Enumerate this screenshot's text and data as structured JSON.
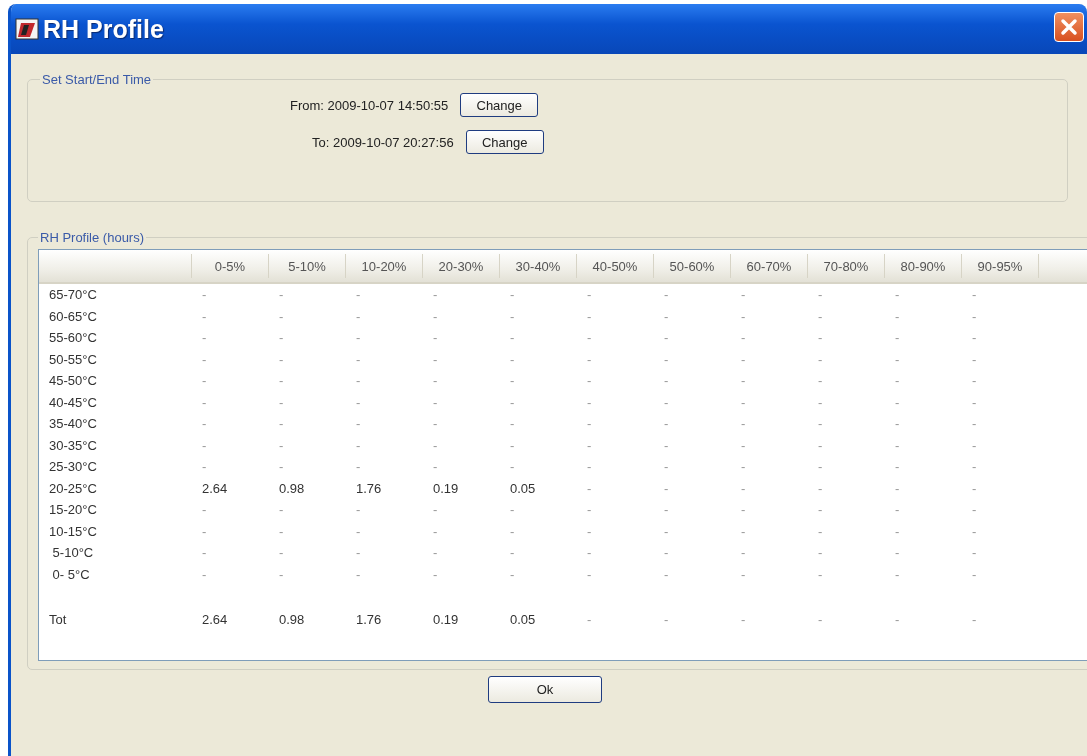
{
  "window": {
    "title": "RH Profile"
  },
  "time_group": {
    "title": "Set Start/End Time",
    "rows": [
      {
        "label": "From: 2009-10-07 14:50:55",
        "button": "Change"
      },
      {
        "label": "To: 2009-10-07 20:27:56",
        "button": "Change"
      }
    ]
  },
  "profile_group": {
    "title": "RH Profile (hours)",
    "table": {
      "columns": [
        "0-5%",
        "5-10%",
        "10-20%",
        "20-30%",
        "30-40%",
        "40-50%",
        "50-60%",
        "60-70%",
        "70-80%",
        "80-90%",
        "90-95%"
      ],
      "rows": [
        {
          "kind": "data",
          "label": "65-70°C",
          "cells": [
            "-",
            "-",
            "-",
            "-",
            "-",
            "-",
            "-",
            "-",
            "-",
            "-",
            "-"
          ]
        },
        {
          "kind": "data",
          "label": "60-65°C",
          "cells": [
            "-",
            "-",
            "-",
            "-",
            "-",
            "-",
            "-",
            "-",
            "-",
            "-",
            "-"
          ]
        },
        {
          "kind": "data",
          "label": "55-60°C",
          "cells": [
            "-",
            "-",
            "-",
            "-",
            "-",
            "-",
            "-",
            "-",
            "-",
            "-",
            "-"
          ]
        },
        {
          "kind": "data",
          "label": "50-55°C",
          "cells": [
            "-",
            "-",
            "-",
            "-",
            "-",
            "-",
            "-",
            "-",
            "-",
            "-",
            "-"
          ]
        },
        {
          "kind": "data",
          "label": "45-50°C",
          "cells": [
            "-",
            "-",
            "-",
            "-",
            "-",
            "-",
            "-",
            "-",
            "-",
            "-",
            "-"
          ]
        },
        {
          "kind": "data",
          "label": "40-45°C",
          "cells": [
            "-",
            "-",
            "-",
            "-",
            "-",
            "-",
            "-",
            "-",
            "-",
            "-",
            "-"
          ]
        },
        {
          "kind": "data",
          "label": "35-40°C",
          "cells": [
            "-",
            "-",
            "-",
            "-",
            "-",
            "-",
            "-",
            "-",
            "-",
            "-",
            "-"
          ]
        },
        {
          "kind": "data",
          "label": "30-35°C",
          "cells": [
            "-",
            "-",
            "-",
            "-",
            "-",
            "-",
            "-",
            "-",
            "-",
            "-",
            "-"
          ]
        },
        {
          "kind": "data",
          "label": "25-30°C",
          "cells": [
            "-",
            "-",
            "-",
            "-",
            "-",
            "-",
            "-",
            "-",
            "-",
            "-",
            "-"
          ]
        },
        {
          "kind": "data",
          "label": "20-25°C",
          "cells": [
            "2.64",
            "0.98",
            "1.76",
            "0.19",
            "0.05",
            "-",
            "-",
            "-",
            "-",
            "-",
            "-"
          ]
        },
        {
          "kind": "data",
          "label": "15-20°C",
          "cells": [
            "-",
            "-",
            "-",
            "-",
            "-",
            "-",
            "-",
            "-",
            "-",
            "-",
            "-"
          ]
        },
        {
          "kind": "data",
          "label": "10-15°C",
          "cells": [
            "-",
            "-",
            "-",
            "-",
            "-",
            "-",
            "-",
            "-",
            "-",
            "-",
            "-"
          ]
        },
        {
          "kind": "data",
          "label": " 5-10°C",
          "cells": [
            "-",
            "-",
            "-",
            "-",
            "-",
            "-",
            "-",
            "-",
            "-",
            "-",
            "-"
          ]
        },
        {
          "kind": "data",
          "label": " 0- 5°C",
          "cells": [
            "-",
            "-",
            "-",
            "-",
            "-",
            "-",
            "-",
            "-",
            "-",
            "-",
            "-"
          ]
        },
        {
          "kind": "total",
          "label": "Tot",
          "cells": [
            "2.64",
            "0.98",
            "1.76",
            "0.19",
            "0.05",
            "-",
            "-",
            "-",
            "-",
            "-",
            "-"
          ]
        }
      ]
    }
  },
  "buttons": [
    "Ok"
  ]
}
